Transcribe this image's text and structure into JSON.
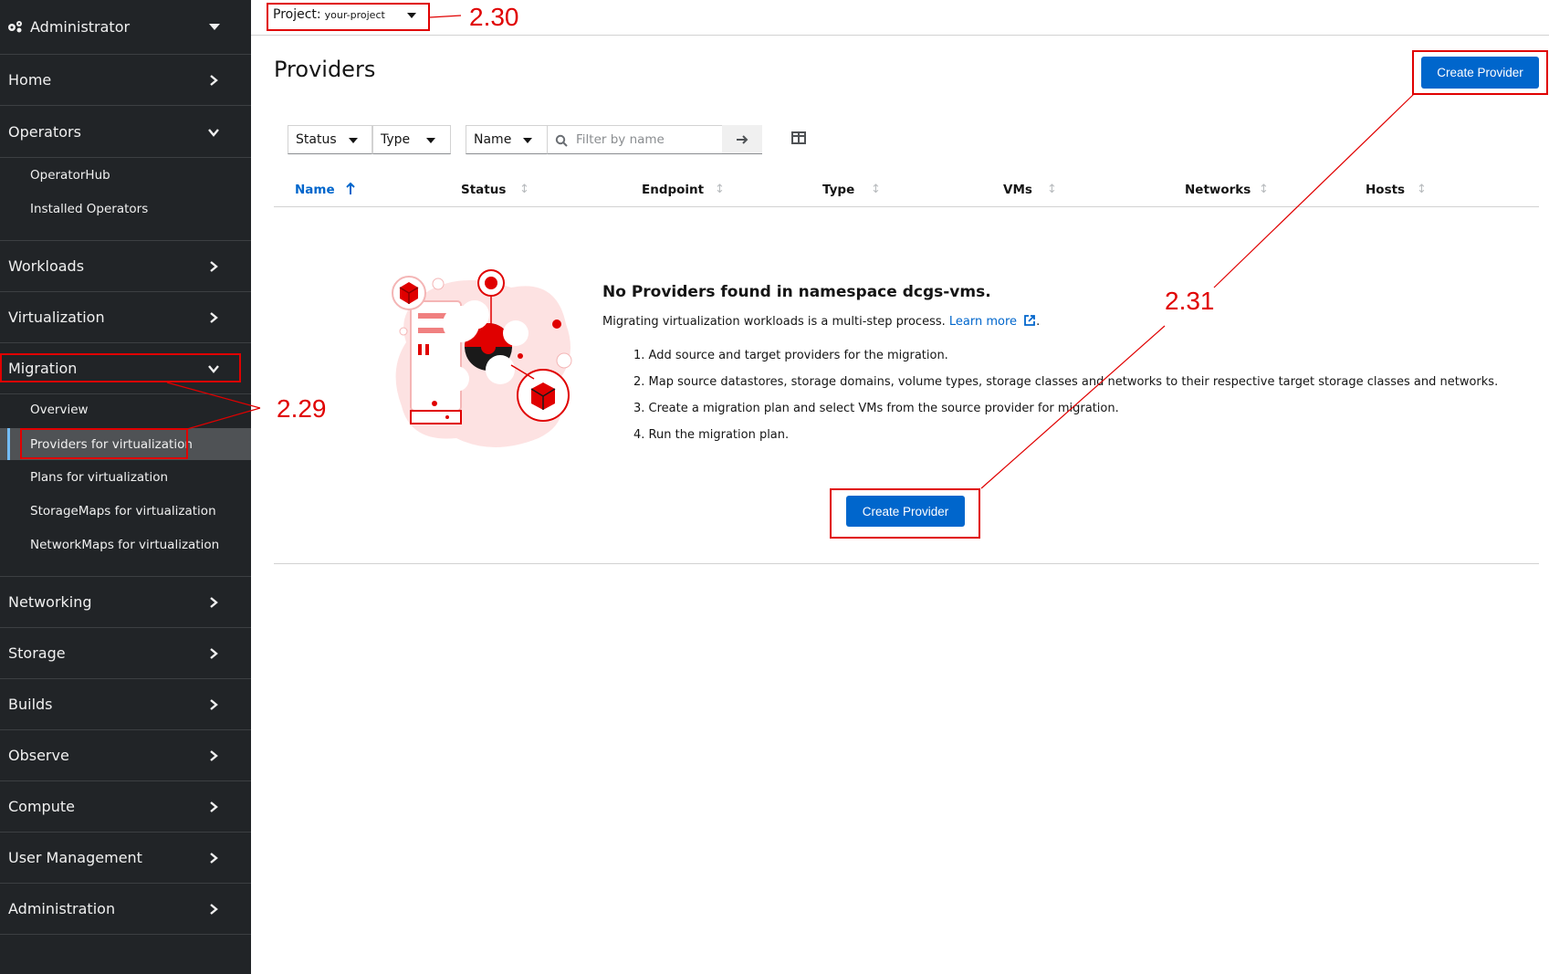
{
  "nav": {
    "perspective": "Administrator",
    "items": [
      {
        "label": "Home"
      },
      {
        "label": "Operators",
        "children": [
          "OperatorHub",
          "Installed Operators"
        ]
      },
      {
        "label": "Workloads"
      },
      {
        "label": "Virtualization"
      },
      {
        "label": "Migration",
        "children": [
          "Overview",
          "Providers for virtualization",
          "Plans for virtualization",
          "StorageMaps for virtualization",
          "NetworkMaps for virtualization"
        ]
      },
      {
        "label": "Networking"
      },
      {
        "label": "Storage"
      },
      {
        "label": "Builds"
      },
      {
        "label": "Observe"
      },
      {
        "label": "Compute"
      },
      {
        "label": "User Management"
      },
      {
        "label": "Administration"
      }
    ]
  },
  "masthead": {
    "project_label": "Project:",
    "project_value": "your-project"
  },
  "page": {
    "title": "Providers",
    "create_button": "Create Provider"
  },
  "filters": {
    "status": "Status",
    "type": "Type",
    "name": "Name",
    "search_placeholder": "Filter by name"
  },
  "table": {
    "columns": [
      "Name",
      "Status",
      "Endpoint",
      "Type",
      "VMs",
      "Networks",
      "Hosts"
    ]
  },
  "empty": {
    "title": "No Providers found in namespace dcgs-vms.",
    "text": "Migrating virtualization workloads is a multi-step process.",
    "link": "Learn more",
    "steps": [
      "Add source and target providers for the migration.",
      "Map source datastores, storage domains, volume types, storage classes and networks to their respective target storage classes and networks.",
      "Create a migration plan and select VMs from the source provider for migration.",
      "Run the migration plan."
    ],
    "button": "Create Provider"
  },
  "annotations": {
    "a229": "2.29",
    "a230": "2.30",
    "a231": "2.31"
  },
  "colors": {
    "primary": "#0066cc",
    "annotation": "#e00000",
    "sidebar": "#212427"
  }
}
